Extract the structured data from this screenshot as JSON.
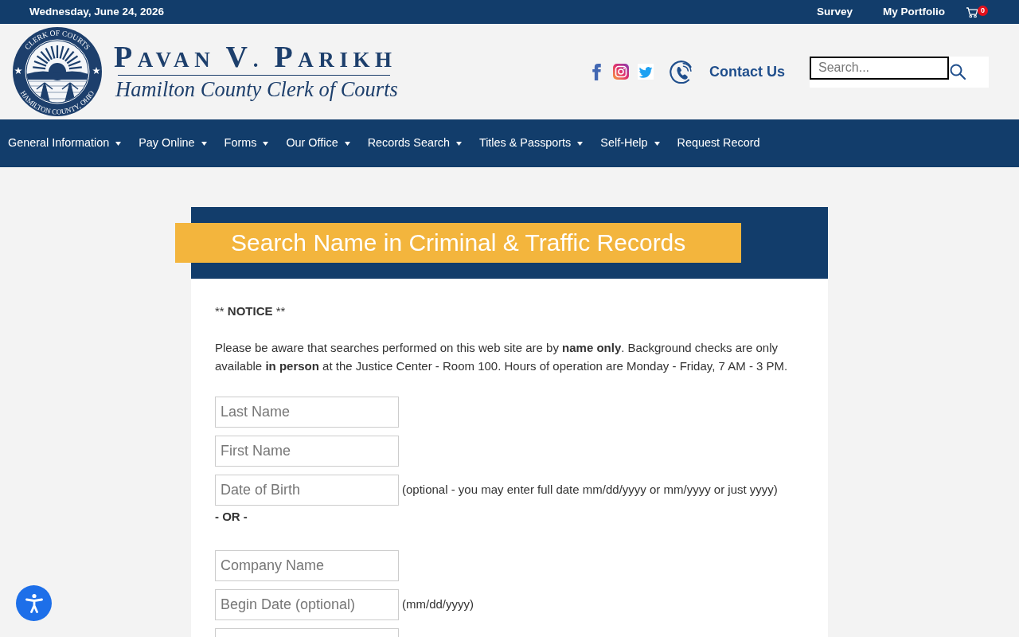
{
  "top_bar": {
    "date": "Wednesday, June 24, 2026",
    "links": [
      "Survey",
      "My Portfolio"
    ],
    "cart_count": "0"
  },
  "header": {
    "seal": {
      "top_text": "CLERK OF COURTS",
      "bottom_text": "HAMILTON COUNTY, OHIO"
    },
    "name": "PAVAN V. PARIKH",
    "subtitle": "Hamilton County Clerk of Courts",
    "contact_label": "Contact Us",
    "search": {
      "placeholder": "Search..."
    }
  },
  "nav": [
    {
      "label": "General Information",
      "has_dropdown": true
    },
    {
      "label": "Pay Online",
      "has_dropdown": true
    },
    {
      "label": "Forms",
      "has_dropdown": true
    },
    {
      "label": "Our Office",
      "has_dropdown": true
    },
    {
      "label": "Records Search",
      "has_dropdown": true
    },
    {
      "label": "Titles & Passports",
      "has_dropdown": true
    },
    {
      "label": "Self-Help",
      "has_dropdown": true
    },
    {
      "label": "Request Record",
      "has_dropdown": false
    }
  ],
  "form": {
    "title": "Search Name in Criminal & Traffic Records",
    "notice": {
      "prefix": "**",
      "label": "NOTICE",
      "suffix": "**"
    },
    "intro": "Please be aware that searches performed on this web site are by **name only**. Background checks are only available **in person** at the Justice Center - Room 100. Hours of operation are Monday - Friday, 7 AM - 3 PM.",
    "items": [
      {
        "kind": "field",
        "placeholder": "Last Name"
      },
      {
        "kind": "field",
        "placeholder": "First Name"
      },
      {
        "kind": "field",
        "placeholder": "Date of Birth",
        "hint": "(optional - you may enter full date mm/dd/yyyy or mm/yyyy or just yyyy)"
      },
      {
        "kind": "separator",
        "text": "- OR -"
      },
      {
        "kind": "field",
        "placeholder": "Company Name"
      },
      {
        "kind": "field",
        "placeholder": "Begin Date (optional)",
        "hint": "(mm/dd/yyyy)"
      },
      {
        "kind": "field"
      }
    ]
  }
}
